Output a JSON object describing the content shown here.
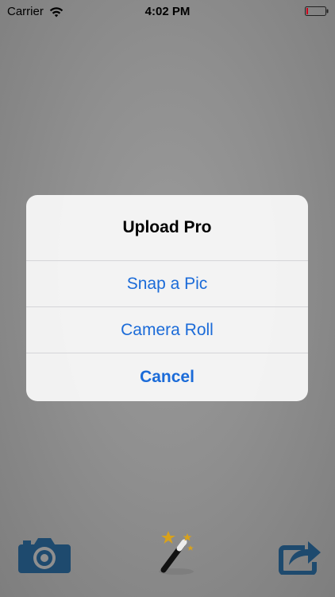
{
  "status_bar": {
    "carrier": "Carrier",
    "time": "4:02 PM",
    "wifi_icon": "wifi-icon",
    "battery_icon": "battery-icon"
  },
  "action_sheet": {
    "title": "Upload Pro",
    "options": [
      {
        "label": "Snap a Pic"
      },
      {
        "label": "Camera Roll"
      },
      {
        "label": "Cancel"
      }
    ]
  },
  "toolbar": {
    "icons": [
      "camera-icon",
      "magic-wand-icon",
      "share-icon"
    ]
  },
  "colors": {
    "accent": "#1b6bd8",
    "toolbar_icon": "#1e4a6e",
    "background": "#8f8f8f"
  }
}
